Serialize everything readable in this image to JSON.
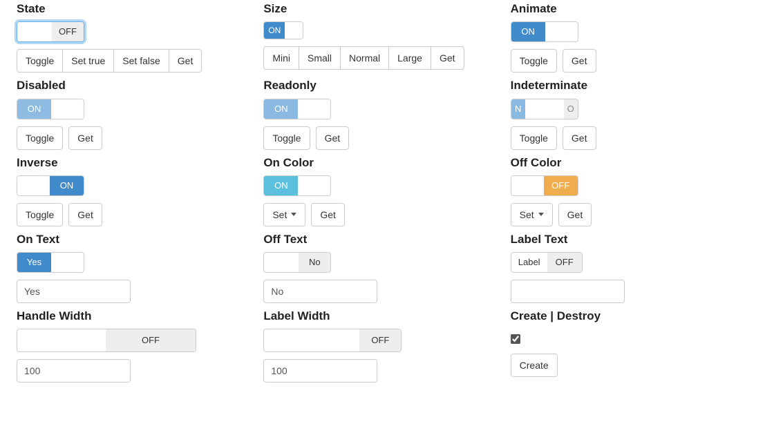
{
  "state": {
    "title": "State",
    "switch_off": "OFF",
    "btn_toggle": "Toggle",
    "btn_set_true": "Set true",
    "btn_set_false": "Set false",
    "btn_get": "Get"
  },
  "size": {
    "title": "Size",
    "switch_on": "ON",
    "btn_mini": "Mini",
    "btn_small": "Small",
    "btn_normal": "Normal",
    "btn_large": "Large",
    "btn_get": "Get"
  },
  "animate": {
    "title": "Animate",
    "switch_on": "ON",
    "btn_toggle": "Toggle",
    "btn_get": "Get"
  },
  "disabled": {
    "title": "Disabled",
    "switch_on": "ON",
    "btn_toggle": "Toggle",
    "btn_get": "Get"
  },
  "readonly": {
    "title": "Readonly",
    "switch_on": "ON",
    "btn_toggle": "Toggle",
    "btn_get": "Get"
  },
  "indeterminate": {
    "title": "Indeterminate",
    "switch_on": "N",
    "switch_off": "O",
    "btn_toggle": "Toggle",
    "btn_get": "Get"
  },
  "inverse": {
    "title": "Inverse",
    "switch_on": "ON",
    "btn_toggle": "Toggle",
    "btn_get": "Get"
  },
  "on_color": {
    "title": "On Color",
    "switch_on": "ON",
    "btn_set": "Set",
    "btn_get": "Get"
  },
  "off_color": {
    "title": "Off Color",
    "switch_off": "OFF",
    "btn_set": "Set",
    "btn_get": "Get"
  },
  "on_text": {
    "title": "On Text",
    "switch_on": "Yes",
    "input_value": "Yes"
  },
  "off_text": {
    "title": "Off Text",
    "switch_off": "No",
    "input_value": "No"
  },
  "label_text": {
    "title": "Label Text",
    "switch_label": "Label",
    "switch_off": "OFF",
    "input_value": ""
  },
  "handle_width": {
    "title": "Handle Width",
    "switch_off": "OFF",
    "input_value": "100"
  },
  "label_width": {
    "title": "Label Width",
    "switch_off": "OFF",
    "input_value": "100"
  },
  "create_destroy": {
    "title": "Create | Destroy",
    "checked": true,
    "btn_create": "Create"
  }
}
